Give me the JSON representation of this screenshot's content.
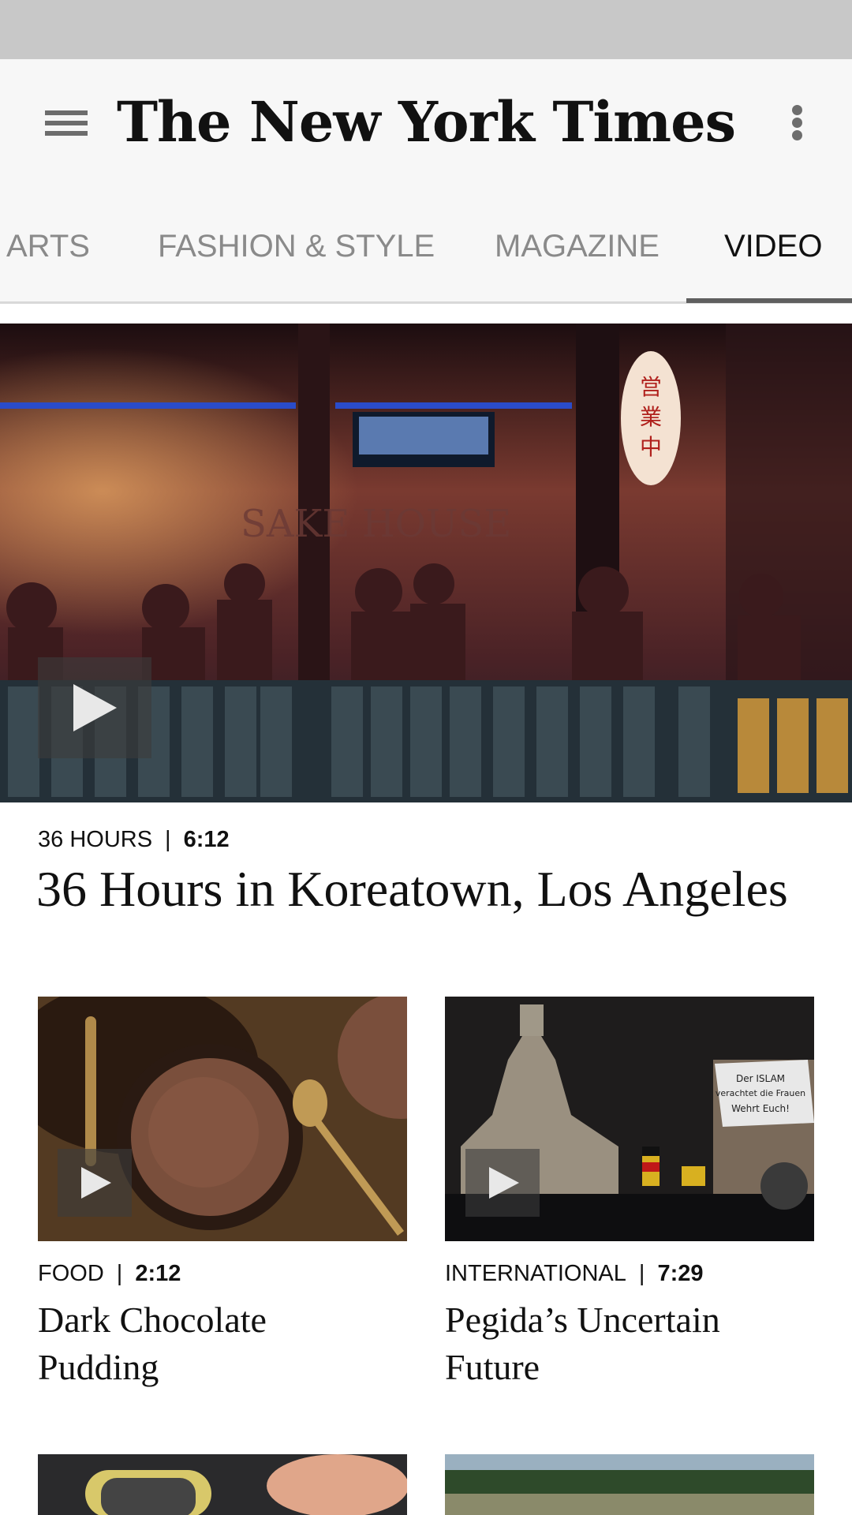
{
  "app": {
    "logo": "The New York Times",
    "menu_icon": "hamburger-menu-icon",
    "overflow_icon": "more-vert-icon"
  },
  "tabs": [
    {
      "label": "ARTS"
    },
    {
      "label": "FASHION & STYLE"
    },
    {
      "label": "MAGAZINE"
    },
    {
      "label": "VIDEO",
      "active": true
    }
  ],
  "hero": {
    "section": "36 HOURS",
    "duration": "6:12",
    "separator": "|",
    "headline": "36 Hours in Koreatown, Los Angeles",
    "sign_text": "SAKE HOUSE",
    "image_icon": "play-icon"
  },
  "cards": [
    {
      "section": "FOOD",
      "duration": "2:12",
      "separator": "|",
      "headline_line1": "Dark Chocolate",
      "headline_line2": "Pudding"
    },
    {
      "section": "INTERNATIONAL",
      "duration": "7:29",
      "separator": "|",
      "headline_line1": "Pegida’s Uncertain",
      "headline_line2": "Future",
      "sign_text": "Der ISLAM verachtet die Frauen Wehrt Euch!"
    }
  ],
  "colors": {
    "status_bar": "#c8c8c8",
    "app_bar": "#f7f7f7",
    "active_tab": "#111111",
    "inactive_tab": "#8a8a8a"
  }
}
